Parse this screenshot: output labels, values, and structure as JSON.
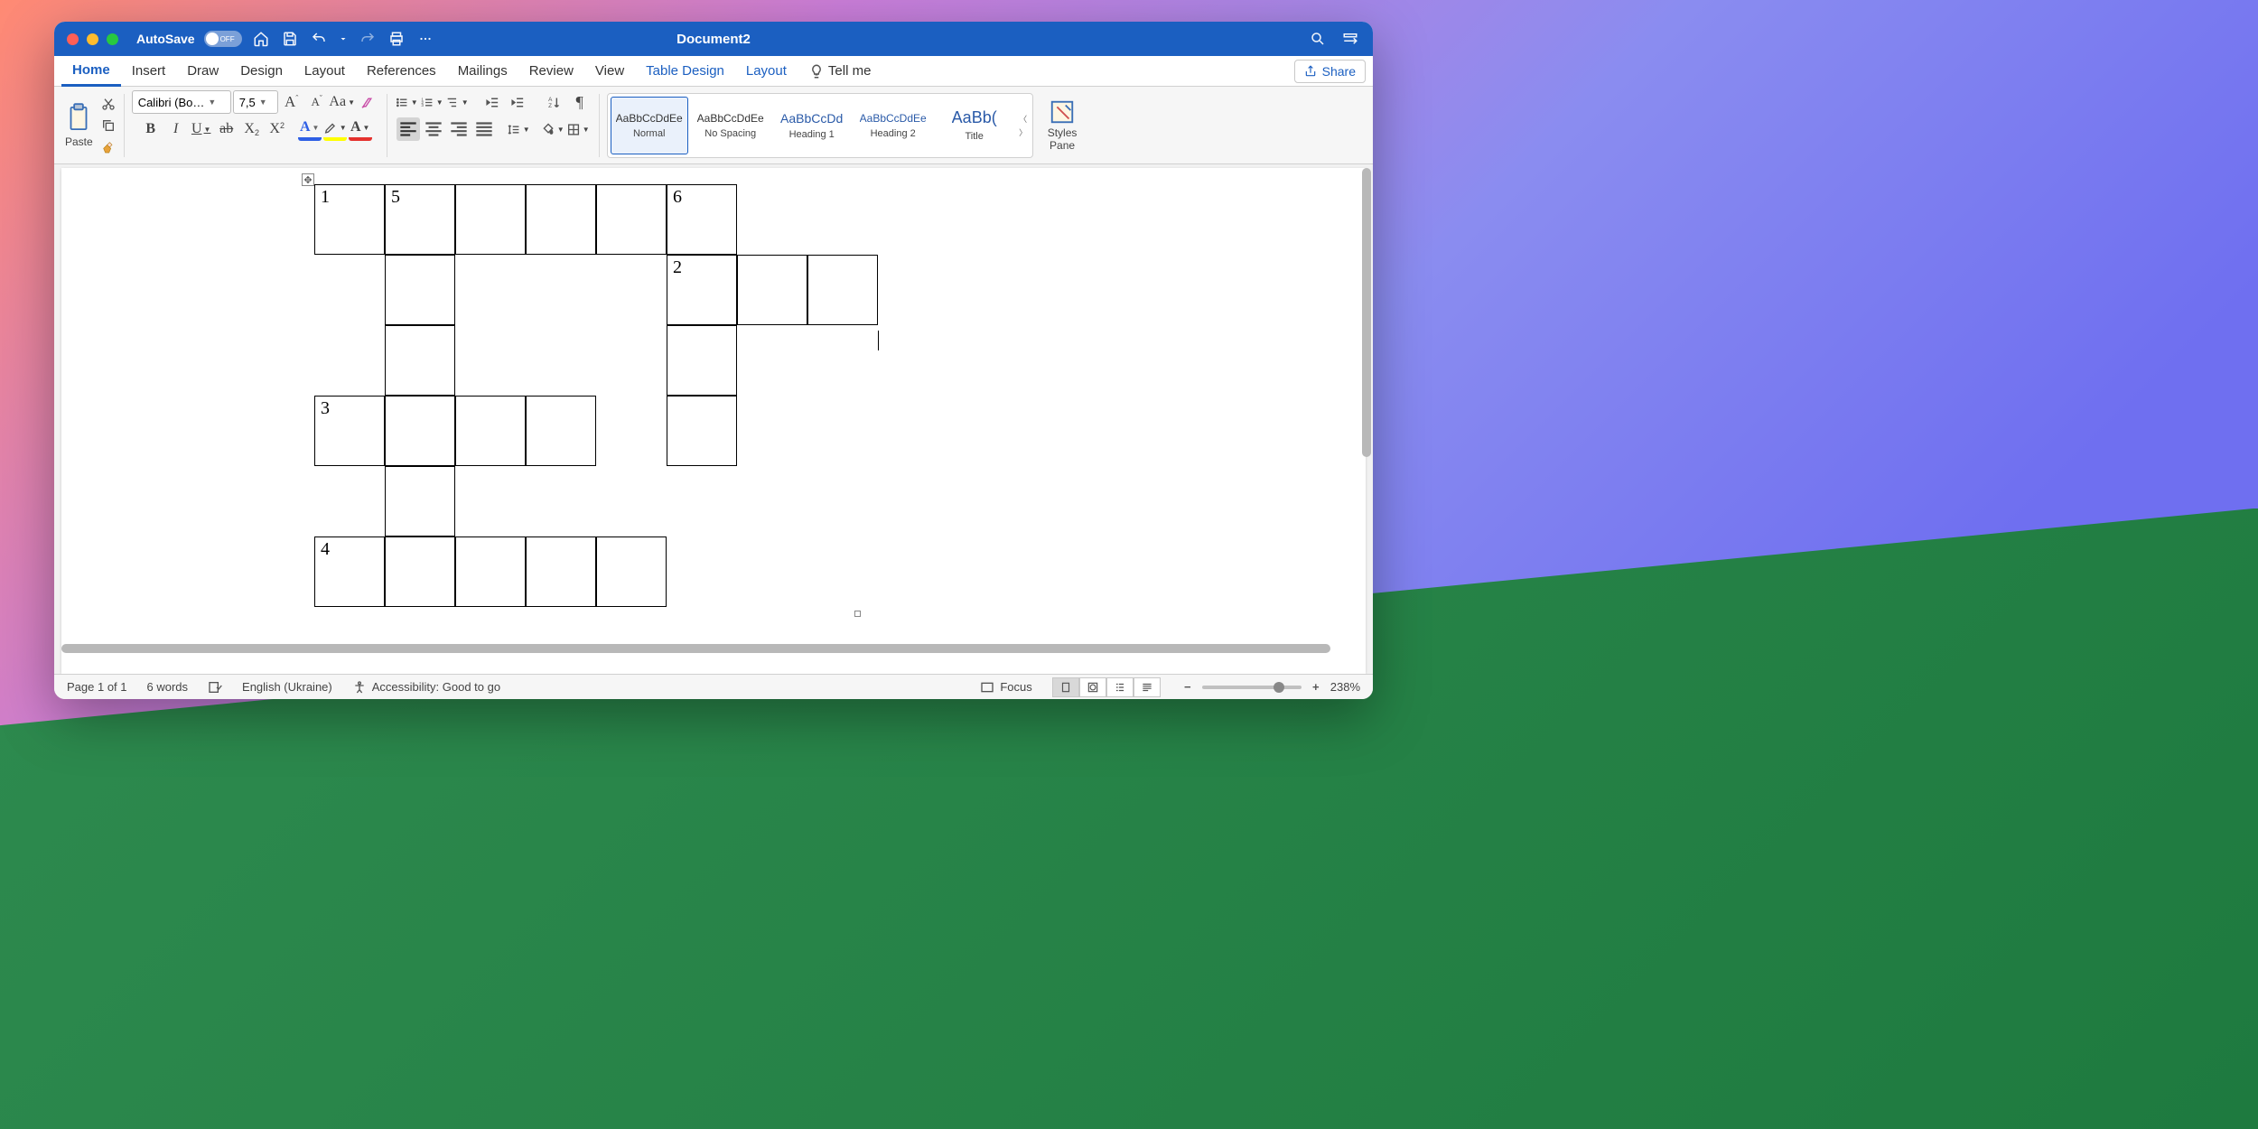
{
  "titlebar": {
    "autosave_label": "AutoSave",
    "autosave_state": "OFF",
    "document_title": "Document2"
  },
  "tabs": {
    "home": "Home",
    "insert": "Insert",
    "draw": "Draw",
    "design": "Design",
    "layout": "Layout",
    "references": "References",
    "mailings": "Mailings",
    "review": "Review",
    "view": "View",
    "table_design": "Table Design",
    "table_layout": "Layout",
    "tell_me": "Tell me",
    "share": "Share"
  },
  "ribbon": {
    "paste": "Paste",
    "font_name": "Calibri (Bo…",
    "font_size": "7,5",
    "styles": {
      "normal": {
        "preview": "AaBbCcDdEe",
        "name": "Normal"
      },
      "no_spacing": {
        "preview": "AaBbCcDdEe",
        "name": "No Spacing"
      },
      "heading1": {
        "preview": "AaBbCcDd",
        "name": "Heading 1"
      },
      "heading2": {
        "preview": "AaBbCcDdEe",
        "name": "Heading 2"
      },
      "title": {
        "preview": "AaBb(",
        "name": "Title"
      }
    },
    "styles_pane_l1": "Styles",
    "styles_pane_l2": "Pane"
  },
  "crossword": {
    "cells": [
      {
        "r": 0,
        "c": 0,
        "num": "1"
      },
      {
        "r": 0,
        "c": 1,
        "num": "5"
      },
      {
        "r": 0,
        "c": 2
      },
      {
        "r": 0,
        "c": 3
      },
      {
        "r": 0,
        "c": 4
      },
      {
        "r": 0,
        "c": 5,
        "num": "6"
      },
      {
        "r": 1,
        "c": 1
      },
      {
        "r": 1,
        "c": 5,
        "num": "2"
      },
      {
        "r": 1,
        "c": 6
      },
      {
        "r": 1,
        "c": 7
      },
      {
        "r": 2,
        "c": 1
      },
      {
        "r": 2,
        "c": 5
      },
      {
        "r": 3,
        "c": 0,
        "num": "3"
      },
      {
        "r": 3,
        "c": 1
      },
      {
        "r": 3,
        "c": 2
      },
      {
        "r": 3,
        "c": 3
      },
      {
        "r": 3,
        "c": 5
      },
      {
        "r": 4,
        "c": 1
      },
      {
        "r": 5,
        "c": 0,
        "num": "4"
      },
      {
        "r": 5,
        "c": 1
      },
      {
        "r": 5,
        "c": 2
      },
      {
        "r": 5,
        "c": 3
      },
      {
        "r": 5,
        "c": 4
      }
    ]
  },
  "statusbar": {
    "page": "Page 1 of 1",
    "words": "6 words",
    "language": "English (Ukraine)",
    "accessibility": "Accessibility: Good to go",
    "focus": "Focus",
    "zoom": "238%"
  }
}
